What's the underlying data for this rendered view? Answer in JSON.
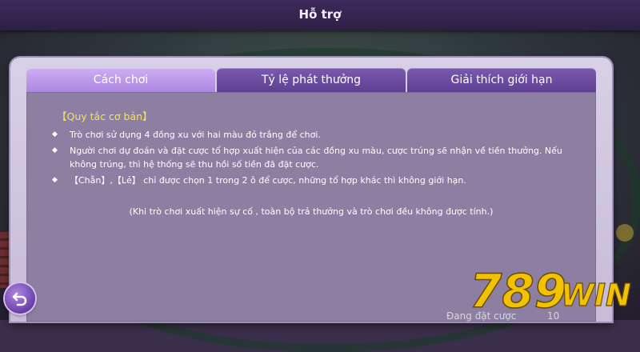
{
  "header": {
    "title": "Hỗ trợ"
  },
  "tabs": [
    {
      "label": "Cách chơi",
      "active": true
    },
    {
      "label": "Tỷ lệ phát thưởng",
      "active": false
    },
    {
      "label": "Giải thích giới hạn",
      "active": false
    }
  ],
  "content": {
    "section_title": "【Quy tắc cơ bản】",
    "rules": [
      "Trò chơi sử dụng 4 đồng xu với hai màu đỏ trắng để chơi.",
      "Người chơi dự đoán và đặt cược tổ hợp xuất hiện của các đồng xu màu, cược trúng sẽ nhận về tiền thưởng. Nếu không trúng, thì hệ thống sẽ thu hồi số tiền đã đặt cược.",
      "【Chẵn】,【Lẻ】 chỉ được chọn 1 trong 2 ô để cược, những tổ hợp khác thì không giới hạn."
    ],
    "note": "(Khi trò chơi xuất hiện sự cố , toàn bộ trả thưởng và trò chơi đều không được tính.)"
  },
  "watermark": {
    "text": "789WIN"
  },
  "footer": {
    "label": "Đang đặt cược",
    "value": "10"
  },
  "icons": {
    "back": "back-arrow-icon",
    "bullet": "diamond-bullet-icon"
  },
  "colors": {
    "accent": "#ac86e0",
    "section_title": "#f5e25a",
    "logo": "#f2c200"
  }
}
